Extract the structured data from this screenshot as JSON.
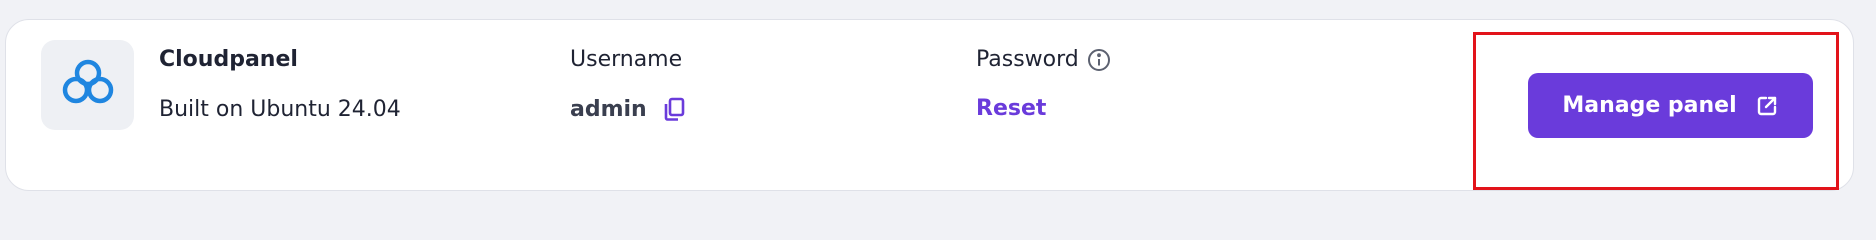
{
  "app": {
    "name": "Cloudpanel",
    "subtitle": "Built on Ubuntu 24.04",
    "icon": "cloud-icon"
  },
  "credentials": {
    "username_label": "Username",
    "username_value": "admin",
    "password_label": "Password",
    "reset_label": "Reset"
  },
  "actions": {
    "manage_label": "Manage panel"
  },
  "colors": {
    "accent": "#6a3bdb",
    "icon_blue": "#1f86e0",
    "highlight": "#e2131a"
  }
}
